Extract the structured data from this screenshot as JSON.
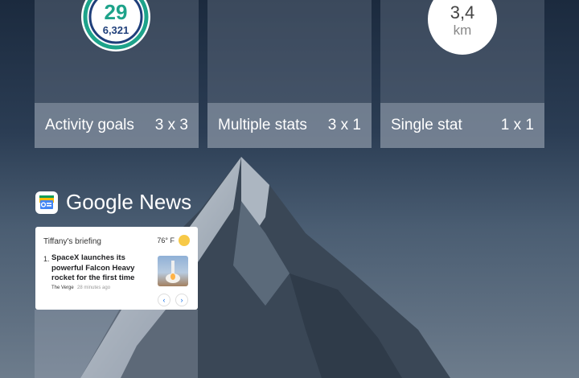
{
  "widgets": [
    {
      "name": "Activity goals",
      "size": "3 x 3"
    },
    {
      "name": "Multiple stats",
      "size": "3 x 1"
    },
    {
      "name": "Single stat",
      "size": "1 x 1"
    }
  ],
  "activity": {
    "value": "29",
    "steps": "6,321"
  },
  "single_stat": {
    "value": "3,4",
    "unit": "km"
  },
  "news": {
    "app_title": "Google News",
    "briefing": "Tiffany's briefing",
    "temperature": "76° F",
    "item_number": "1.",
    "headline": "SpaceX launches its powerful Falcon Heavy rocket for the first time",
    "source": "The Verge",
    "time": "28 minutes ago"
  },
  "icons": {
    "weather": "partly-cloudy-icon",
    "prev": "chevron-left-icon",
    "next": "chevron-right-icon"
  }
}
